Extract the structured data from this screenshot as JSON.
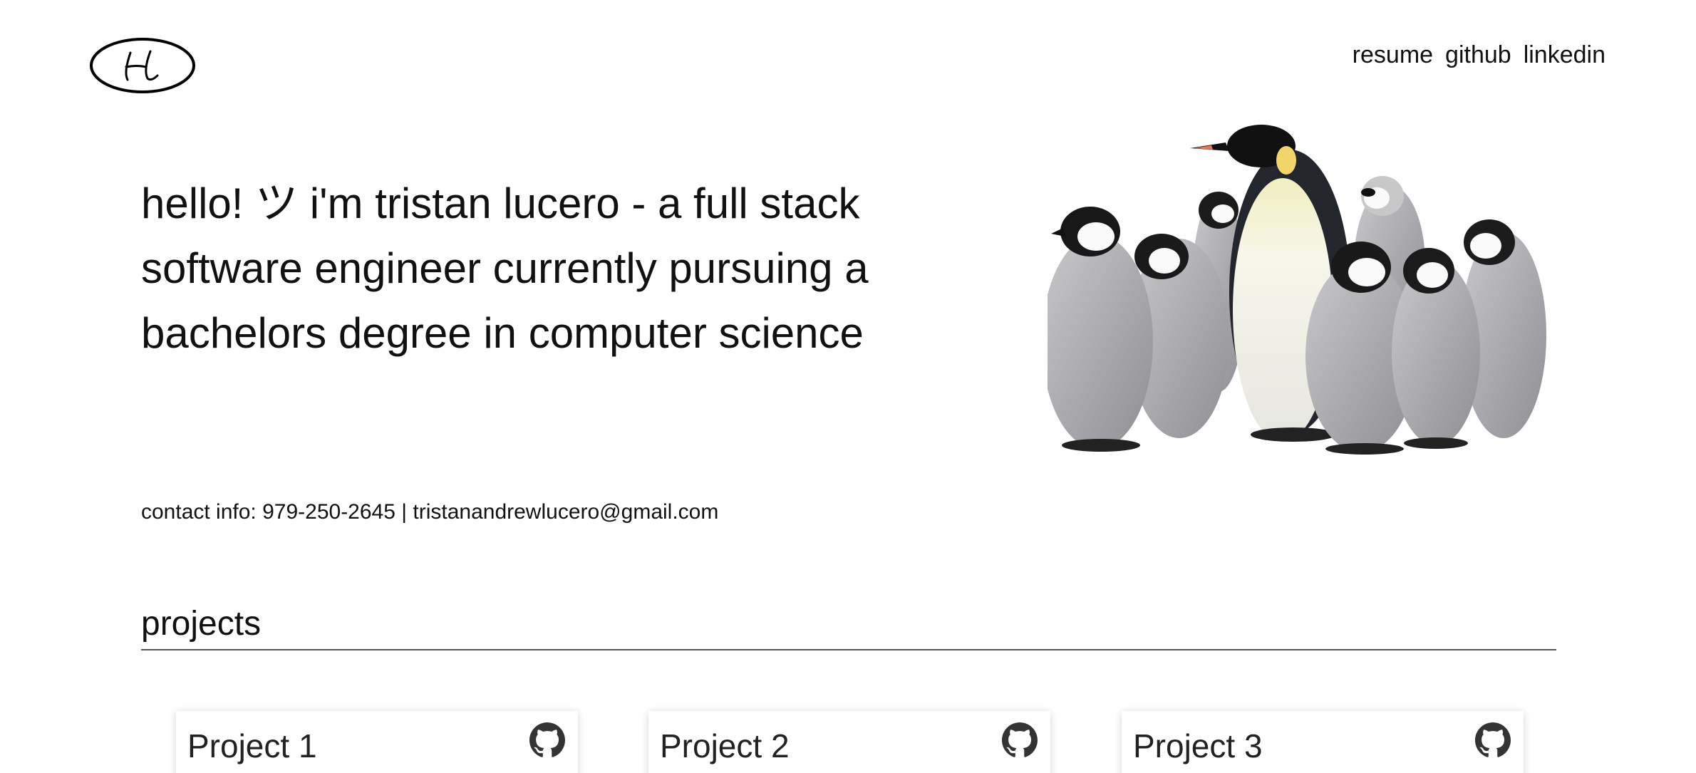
{
  "header": {
    "logo_text": "Hl",
    "nav": [
      {
        "label": "resume"
      },
      {
        "label": "github"
      },
      {
        "label": "linkedin"
      }
    ]
  },
  "hero": {
    "lines": [
      "hello! ツ i'm tristan lucero - a full stack",
      "software engineer currently pursuing a",
      "bachelors degree in computer science"
    ],
    "image": "penguins-photo"
  },
  "contact": {
    "text": "contact info: 979-250-2645 | tristanandrewlucero@gmail.com"
  },
  "projects": {
    "heading": "projects",
    "items": [
      {
        "title": "Project 1",
        "icon": "github-icon"
      },
      {
        "title": "Project 2",
        "icon": "github-icon"
      },
      {
        "title": "Project 3",
        "icon": "github-icon"
      }
    ]
  },
  "colors": {
    "text": "#111111",
    "rule": "#555555",
    "background": "#ffffff"
  }
}
